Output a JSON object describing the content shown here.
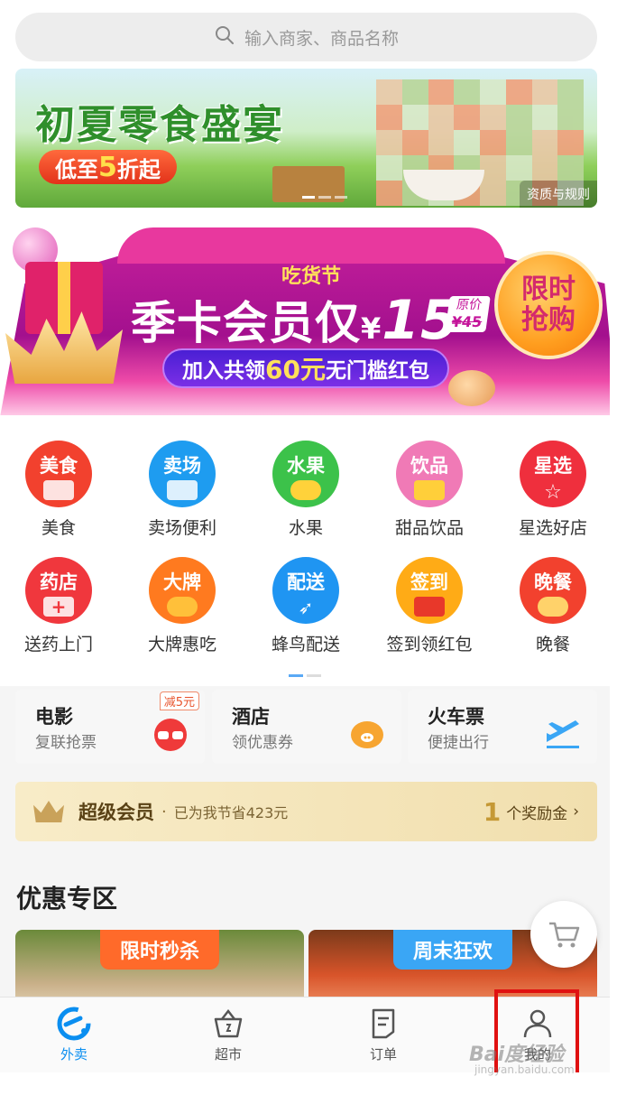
{
  "search": {
    "placeholder": "输入商家、商品名称"
  },
  "banner1": {
    "title": "初夏零食盛宴",
    "pill_prefix": "低至",
    "pill_num": "5",
    "pill_suffix": "折起",
    "qualification": "资质与规则"
  },
  "banner2": {
    "sub": "吃货节",
    "main_text": "季卡会员仅",
    "main_yen": "¥",
    "main_price": "15",
    "orig_label": "原价",
    "orig_price": "¥45",
    "join_prefix": "加入共领",
    "join_amount": "60元",
    "join_suffix": "无门槛红包",
    "limit_line1": "限时",
    "limit_line2": "抢购"
  },
  "categories": [
    {
      "icon_text": "美食",
      "label": "美食",
      "color": "#f2412e"
    },
    {
      "icon_text": "卖场",
      "label": "卖场便利",
      "color": "#1e9cf0"
    },
    {
      "icon_text": "水果",
      "label": "水果",
      "color": "#3cc24a"
    },
    {
      "icon_text": "饮品",
      "label": "甜品饮品",
      "color": "#f07ab6"
    },
    {
      "icon_text": "星选",
      "label": "星选好店",
      "color": "#ef2f3d"
    },
    {
      "icon_text": "药店",
      "label": "送药上门",
      "color": "#f0373d"
    },
    {
      "icon_text": "大牌",
      "label": "大牌惠吃",
      "color": "#ff7a1f"
    },
    {
      "icon_text": "配送",
      "label": "蜂鸟配送",
      "color": "#1f95f2"
    },
    {
      "icon_text": "签到",
      "label": "签到领红包",
      "color": "#ffab16"
    },
    {
      "icon_text": "晚餐",
      "label": "晚餐",
      "color": "#f2412e"
    }
  ],
  "services": [
    {
      "title": "电影",
      "subtitle": "复联抢票",
      "tag": "减5元"
    },
    {
      "title": "酒店",
      "subtitle": "领优惠券"
    },
    {
      "title": "火车票",
      "subtitle": "便捷出行"
    }
  ],
  "vip": {
    "name": "超级会员",
    "dot": "·",
    "saved": "已为我节省423元",
    "count": "1",
    "reward": "个奖励金",
    "chevron": "›"
  },
  "promo": {
    "title": "优惠专区",
    "cards": [
      {
        "tag": "限时秒杀",
        "tag_color": "#ff6a2a"
      },
      {
        "tag": "周末狂欢",
        "tag_color": "#3aa6f5"
      }
    ]
  },
  "tabs": [
    {
      "label": "外卖",
      "active": true
    },
    {
      "label": "超市"
    },
    {
      "label": "订单"
    },
    {
      "label": "我的"
    }
  ],
  "watermark": {
    "text": "Bai度经验",
    "url": "jingyan.baidu.com"
  }
}
